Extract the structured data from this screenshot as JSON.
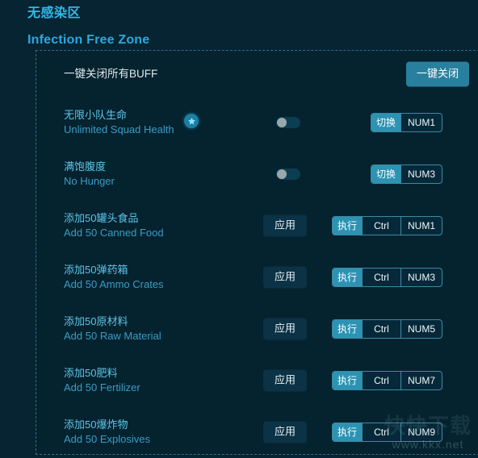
{
  "header": {
    "title_cn": "无感染区",
    "title_en": "Infection Free Zone"
  },
  "panel": {
    "header_row": {
      "label": "一键关闭所有BUFF",
      "button": "一键关闭"
    },
    "rows": [
      {
        "label_cn": "无限小队生命",
        "label_en": "Unlimited Squad Health",
        "badge": "star-icon",
        "control": "toggle",
        "toggle_on": false,
        "hotkey_action": "切换",
        "hotkey_keys": [
          "NUM1"
        ]
      },
      {
        "label_cn": "满饱腹度",
        "label_en": "No Hunger",
        "badge": null,
        "control": "toggle",
        "toggle_on": false,
        "hotkey_action": "切换",
        "hotkey_keys": [
          "NUM3"
        ]
      },
      {
        "label_cn": "添加50罐头食品",
        "label_en": "Add 50 Canned Food",
        "badge": null,
        "control": "apply",
        "apply_label": "应用",
        "hotkey_action": "执行",
        "hotkey_keys": [
          "Ctrl",
          "NUM1"
        ]
      },
      {
        "label_cn": "添加50弹药箱",
        "label_en": "Add 50 Ammo Crates",
        "badge": null,
        "control": "apply",
        "apply_label": "应用",
        "hotkey_action": "执行",
        "hotkey_keys": [
          "Ctrl",
          "NUM3"
        ]
      },
      {
        "label_cn": "添加50原材料",
        "label_en": "Add 50 Raw Material",
        "badge": null,
        "control": "apply",
        "apply_label": "应用",
        "hotkey_action": "执行",
        "hotkey_keys": [
          "Ctrl",
          "NUM5"
        ]
      },
      {
        "label_cn": "添加50肥料",
        "label_en": "Add 50 Fertilizer",
        "badge": null,
        "control": "apply",
        "apply_label": "应用",
        "hotkey_action": "执行",
        "hotkey_keys": [
          "Ctrl",
          "NUM7"
        ]
      },
      {
        "label_cn": "添加50爆炸物",
        "label_en": "Add 50 Explosives",
        "badge": null,
        "control": "apply",
        "apply_label": "应用",
        "hotkey_action": "执行",
        "hotkey_keys": [
          "Ctrl",
          "NUM9"
        ]
      }
    ]
  },
  "watermark": {
    "logo": "快快下载",
    "url": "www.kkx.net"
  },
  "colors": {
    "background": "#062431",
    "panel_background": "#05222f",
    "accent_cyan": "#31b9e8",
    "accent_teal": "#2d93b3",
    "button_primary": "#28809e",
    "label_cn": "#5cc6e8",
    "label_en": "#3a9dc4",
    "border_dashed": "#2f6f86"
  }
}
